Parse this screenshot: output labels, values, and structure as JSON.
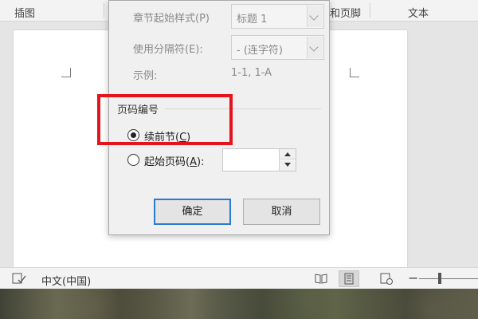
{
  "ribbon": {
    "group_insert": "插图",
    "group_header_footer": "和页脚",
    "group_text": "文本"
  },
  "dialog": {
    "chapter_style_label": "章节起始样式(P)",
    "chapter_style_value": "标题 1",
    "separator_label": "使用分隔符(E):",
    "separator_value": "-  (连字符)",
    "example_label": "示例:",
    "example_value": "1-1, 1-A",
    "page_numbering": {
      "title": "页码编号",
      "continue_prefix": "续前节(",
      "continue_key": "C",
      "continue_suffix": ")",
      "start_prefix": "起始页码(",
      "start_key": "A",
      "start_suffix": "):",
      "start_value": "",
      "selected": "continue"
    },
    "ok_label": "确定",
    "cancel_label": "取消"
  },
  "status": {
    "language": "中文(中国)"
  },
  "colors": {
    "highlight": "#e3141c",
    "primary_border": "#2b79d1"
  },
  "icons": [
    "proofing-icon",
    "read-mode-icon",
    "print-layout-icon",
    "web-layout-icon",
    "zoom-out-icon"
  ]
}
